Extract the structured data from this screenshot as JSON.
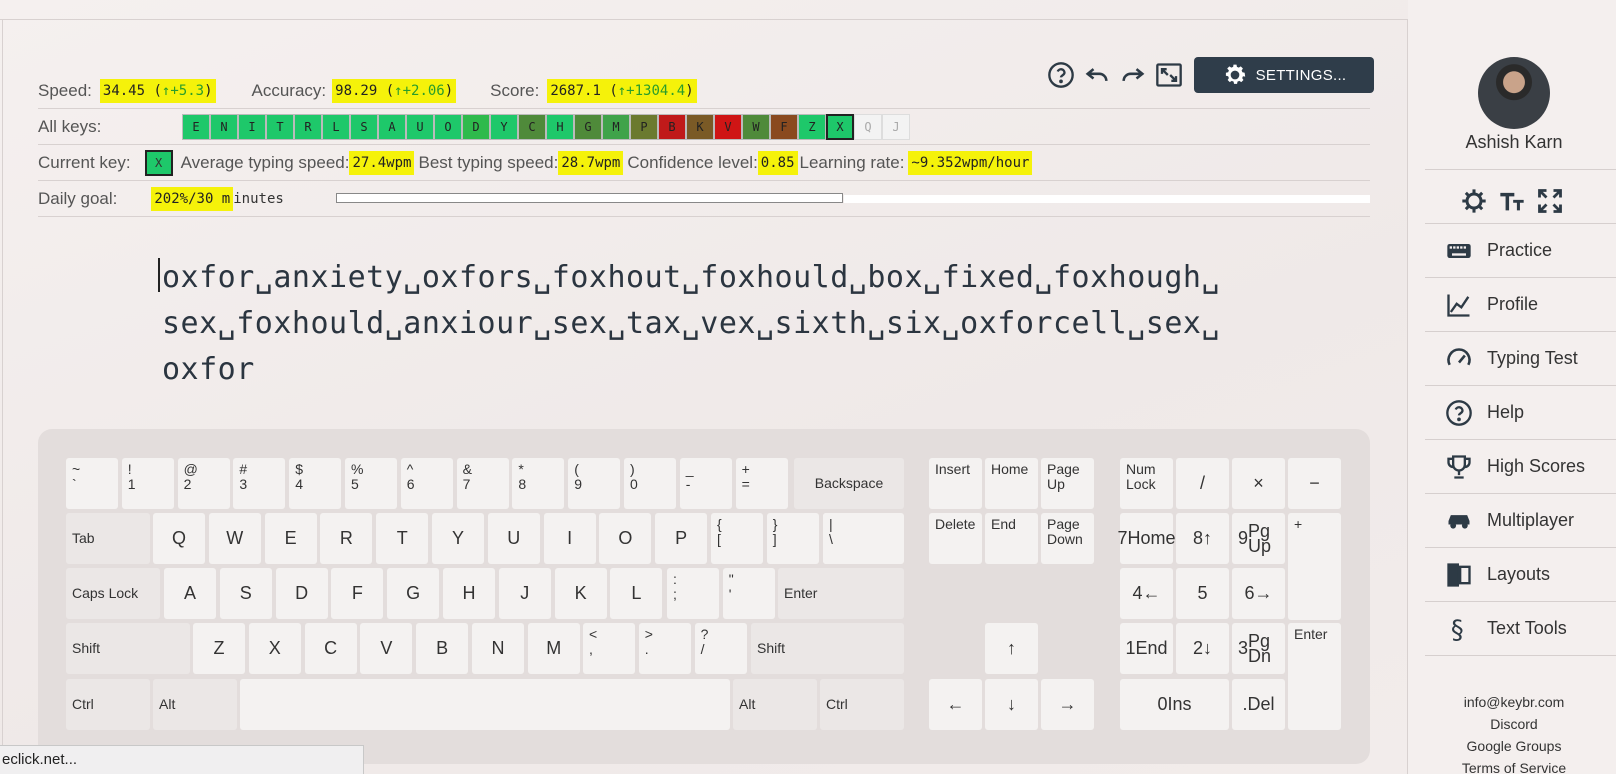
{
  "toolbar": {
    "settings_label": "SETTINGS...",
    "icons": [
      "help-icon",
      "undo-icon",
      "redo-icon",
      "fullscreen-icon",
      "gear-icon"
    ]
  },
  "stats": {
    "speed_label": "Speed:",
    "speed_value": "34.45 (",
    "speed_delta": "↑+5.3",
    "speed_close": ")",
    "accuracy_label": "Accuracy:",
    "accuracy_value": "98.29 (",
    "accuracy_delta": "↑+2.06",
    "accuracy_close": ")",
    "score_label": "Score:",
    "score_value": "2687.1 (",
    "score_delta": "↑+1304.4",
    "score_close": ")"
  },
  "all_keys": {
    "label": "All keys:",
    "keys": [
      {
        "k": "E",
        "color": "#1ec86a"
      },
      {
        "k": "N",
        "color": "#1ec86a"
      },
      {
        "k": "I",
        "color": "#1ec86a"
      },
      {
        "k": "T",
        "color": "#1ec86a"
      },
      {
        "k": "R",
        "color": "#1ec86a"
      },
      {
        "k": "L",
        "color": "#1ec86a"
      },
      {
        "k": "S",
        "color": "#1ec86a"
      },
      {
        "k": "A",
        "color": "#1ec86a"
      },
      {
        "k": "U",
        "color": "#1ec86a"
      },
      {
        "k": "O",
        "color": "#1ec86a"
      },
      {
        "k": "D",
        "color": "#2fba4c"
      },
      {
        "k": "Y",
        "color": "#1ec86a"
      },
      {
        "k": "C",
        "color": "#4f8a3a"
      },
      {
        "k": "H",
        "color": "#1ec86a"
      },
      {
        "k": "G",
        "color": "#4f8a3a"
      },
      {
        "k": "M",
        "color": "#3fa34a"
      },
      {
        "k": "P",
        "color": "#6b7a2f"
      },
      {
        "k": "B",
        "color": "#c01a1a"
      },
      {
        "k": "K",
        "color": "#7a5a26"
      },
      {
        "k": "V",
        "color": "#cf1515"
      },
      {
        "k": "W",
        "color": "#4f8a3a"
      },
      {
        "k": "F",
        "color": "#8a4a1f"
      },
      {
        "k": "Z",
        "color": "#1ec86a"
      },
      {
        "k": "X",
        "color": "#1ec86a"
      },
      {
        "k": "Q",
        "color": "#f3f3f3"
      },
      {
        "k": "J",
        "color": "#f3f3f3"
      }
    ]
  },
  "current": {
    "label": "Current key:",
    "key": "X",
    "avg_label": "Average typing speed:",
    "avg_value": "27.4wpm",
    "best_label": "Best typing speed:",
    "best_value": "28.7wpm",
    "conf_label": "Confidence level:",
    "conf_value": "0.85",
    "rate_label": "Learning rate:",
    "rate_value": "~9.352wpm/hour"
  },
  "goal": {
    "label": "Daily goal:",
    "value_hl": "202%/30 m",
    "value_rest": "inutes",
    "progress": 1.0
  },
  "lesson": {
    "line1": "oxfor␣anxiety␣oxfors␣foxhout␣foxhould␣box␣fixed␣foxhough␣",
    "line2": "sex␣foxhould␣anxiour␣sex␣tax␣vex␣sixth␣six␣oxforcell␣sex␣",
    "line3": "oxfor"
  },
  "keyboard": {
    "row1": [
      [
        "~",
        "`"
      ],
      [
        "!",
        "1"
      ],
      [
        "@",
        "2"
      ],
      [
        "#",
        "3"
      ],
      [
        "$",
        "4"
      ],
      [
        "%",
        "5"
      ],
      [
        "^",
        "6"
      ],
      [
        "&",
        "7"
      ],
      [
        "*",
        "8"
      ],
      [
        "(",
        "9"
      ],
      [
        ")",
        "0"
      ],
      [
        "_",
        "-"
      ],
      [
        "+",
        "="
      ]
    ],
    "backspace": "Backspace",
    "tab": "Tab",
    "row2": [
      "Q",
      "W",
      "E",
      "R",
      "T",
      "Y",
      "U",
      "I",
      "O",
      "P"
    ],
    "row2_sym": [
      [
        "{",
        "["
      ],
      [
        "}",
        "]"
      ],
      [
        "|",
        "\\"
      ]
    ],
    "caps": "Caps Lock",
    "row3": [
      "A",
      "S",
      "D",
      "F",
      "G",
      "H",
      "J",
      "K",
      "L"
    ],
    "row3_sym": [
      [
        ":",
        ";"
      ],
      [
        "\"",
        "'"
      ]
    ],
    "enter": "Enter",
    "shift": "Shift",
    "row4": [
      "Z",
      "X",
      "C",
      "V",
      "B",
      "N",
      "M"
    ],
    "row4_sym": [
      [
        "<",
        ","
      ],
      [
        ">",
        "."
      ],
      [
        "?",
        "/"
      ]
    ],
    "ctrl": "Ctrl",
    "alt": "Alt",
    "nav": [
      "Insert",
      "Home",
      "Page Up",
      "Delete",
      "End",
      "Page Down"
    ],
    "arrows": [
      "↑",
      "←",
      "↓",
      "→"
    ],
    "numpad": {
      "numlock": "Num Lock",
      "slash": "/",
      "times": "×",
      "minus": "−",
      "plus": "+",
      "enter": "Enter",
      "n7": [
        "7",
        "Home"
      ],
      "n8": [
        "8",
        "↑"
      ],
      "n9": [
        "9",
        "Pg Up"
      ],
      "n4": [
        "4",
        "←"
      ],
      "n5": [
        "5",
        ""
      ],
      "n6": [
        "6",
        "→"
      ],
      "n1": [
        "1",
        "End"
      ],
      "n2": [
        "2",
        "↓"
      ],
      "n3": [
        "3",
        "Pg Dn"
      ],
      "n0": [
        "0",
        "Ins"
      ],
      "dot": [
        ".",
        "Del"
      ]
    }
  },
  "sidebar": {
    "user_name": "Ashish Karn",
    "nav": [
      {
        "label": "Practice",
        "icon": "keyboard-icon"
      },
      {
        "label": "Profile",
        "icon": "chart-icon"
      },
      {
        "label": "Typing Test",
        "icon": "speedometer-icon"
      },
      {
        "label": "Help",
        "icon": "help-icon"
      },
      {
        "label": "High Scores",
        "icon": "trophy-icon"
      },
      {
        "label": "Multiplayer",
        "icon": "car-icon"
      },
      {
        "label": "Layouts",
        "icon": "layouts-icon"
      },
      {
        "label": "Text Tools",
        "icon": "section-icon"
      }
    ],
    "footer": [
      "info@keybr.com",
      "Discord",
      "Google Groups",
      "Terms of Service"
    ]
  },
  "status_bar": "eclick.net..."
}
